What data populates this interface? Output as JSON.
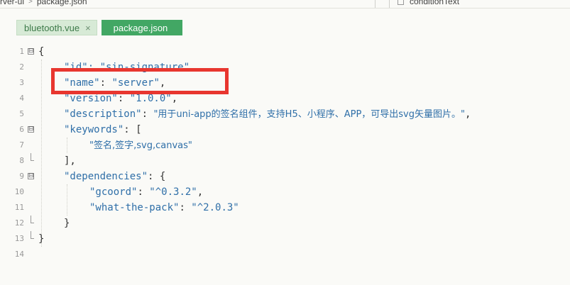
{
  "breadcrumb": {
    "folder": "rver-ui",
    "separator": ">",
    "file": "package.json"
  },
  "right_panel": {
    "label": "conditionText"
  },
  "tabs": [
    {
      "label": "bluetooth.vue",
      "close": "×",
      "active": false
    },
    {
      "label": "package.json",
      "active": true
    }
  ],
  "code": {
    "line_numbers": [
      "1",
      "2",
      "3",
      "4",
      "5",
      "6",
      "7",
      "8",
      "9",
      "10",
      "11",
      "12",
      "13",
      "14"
    ],
    "fold_markers": [
      "⊟",
      "⊟",
      "⊟"
    ],
    "l1": "{",
    "l2_key": "\"id\"",
    "l2_rest": ": \"sin-signature\",",
    "l3_key": "\"name\"",
    "l3_colon": ": ",
    "l3_val": "\"server\"",
    "l3_comma": ",",
    "l4_key": "\"version\"",
    "l4_colon": ": ",
    "l4_val": "\"1.0.0\"",
    "l4_comma": ",",
    "l5_key": "\"description\"",
    "l5_colon": ": ",
    "l5_val": "\"用于uni-app的签名组件，支持H5、小程序、APP，可导出svg矢量图片。\"",
    "l5_comma": ",",
    "l6_key": "\"keywords\"",
    "l6_rest": ": [",
    "l7_val": "\"签名,签字,svg,canvas\"",
    "l8": "],",
    "l9_key": "\"dependencies\"",
    "l9_rest": ": {",
    "l10_key": "\"gcoord\"",
    "l10_colon": ": ",
    "l10_val": "\"^0.3.2\"",
    "l10_comma": ",",
    "l11_key": "\"what-the-pack\"",
    "l11_colon": ": ",
    "l11_val": "\"^2.0.3\"",
    "l12": "}",
    "l13": "}"
  },
  "colors": {
    "accent_tab": "#42a764",
    "highlight_box": "#e8362f",
    "code_string": "#2f6fa8"
  }
}
